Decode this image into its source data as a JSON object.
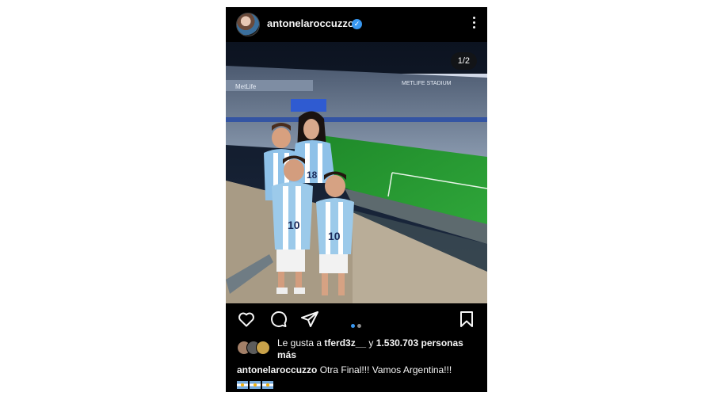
{
  "post": {
    "username": "antonelaroccuzzo",
    "verified": true,
    "slide_counter": "1/2",
    "slide_total": 2,
    "slide_current": 1,
    "stadium_signs": [
      "METLIFE STADIUM",
      "MetLife"
    ],
    "jersey_numbers": [
      "18",
      "10",
      "10"
    ],
    "likes": {
      "prefix": "Le gusta a",
      "user": "tferd3z__",
      "joiner": "y",
      "count": "1.530.703",
      "suffix": "personas más"
    },
    "caption": {
      "user": "antonelaroccuzzo",
      "text": "Otra Final!!! Vamos Argentina!!!",
      "flags_emoji": "🇦🇷🇦🇷🇦🇷"
    }
  },
  "icons": {
    "like": "heart-icon",
    "comment": "comment-icon",
    "share": "share-icon",
    "save": "bookmark-icon",
    "more": "more-icon",
    "verified": "verified-badge-icon"
  },
  "colors": {
    "background": "#000000",
    "text": "#f5f5f5",
    "accent": "#3897f0",
    "argentina_blue": "#75aadb"
  }
}
